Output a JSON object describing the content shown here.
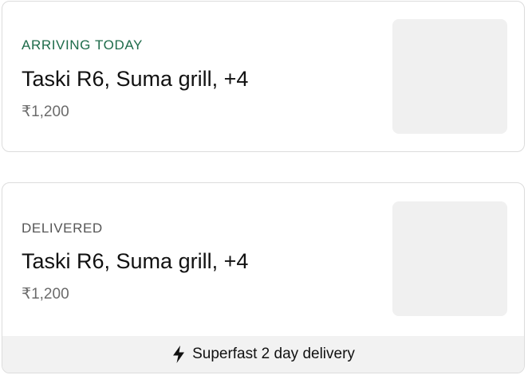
{
  "orders": [
    {
      "status": "ARRIVING TODAY",
      "status_color": "#1e6b4a",
      "title": "Taski R6, Suma grill, +4",
      "price": "₹1,200"
    },
    {
      "status": "DELIVERED",
      "status_color": "#555555",
      "title": "Taski R6, Suma grill, +4",
      "price": "₹1,200",
      "footer": {
        "icon": "lightning-bolt-icon",
        "text": "Superfast 2 day delivery"
      }
    }
  ]
}
